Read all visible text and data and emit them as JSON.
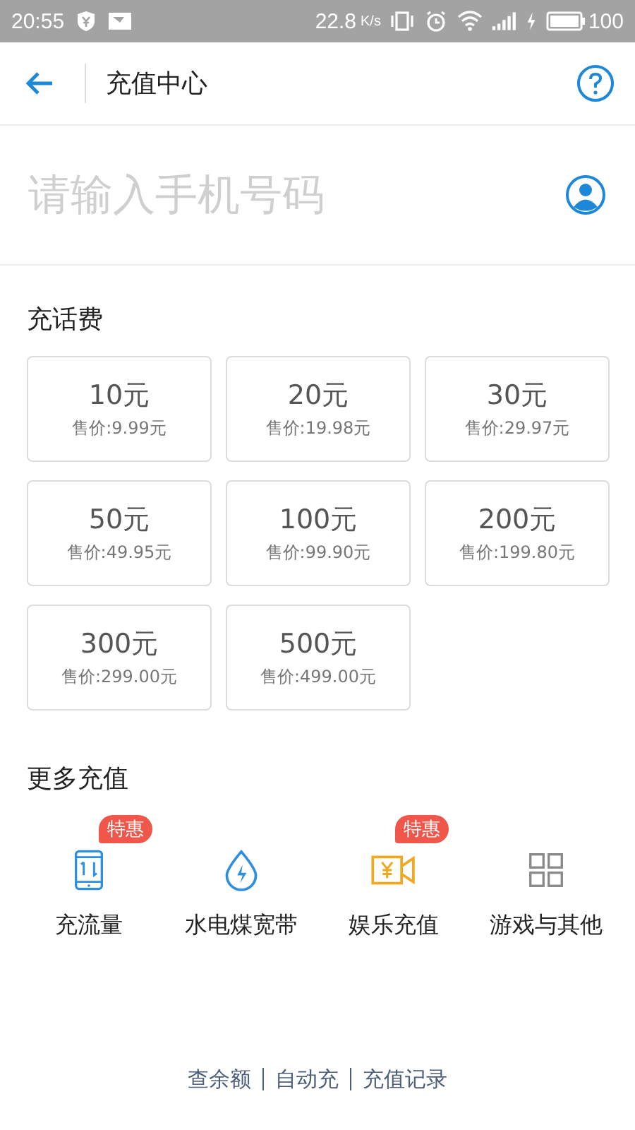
{
  "status_bar": {
    "time": "20:55",
    "speed": "22.8",
    "speed_unit": "K/s",
    "battery": "100"
  },
  "header": {
    "title": "充值中心"
  },
  "phone_field": {
    "placeholder": "请输入手机号码"
  },
  "topup": {
    "title": "充话费",
    "options": [
      {
        "amount": "10元",
        "price": "售价:9.99元"
      },
      {
        "amount": "20元",
        "price": "售价:19.98元"
      },
      {
        "amount": "30元",
        "price": "售价:29.97元"
      },
      {
        "amount": "50元",
        "price": "售价:49.95元"
      },
      {
        "amount": "100元",
        "price": "售价:99.90元"
      },
      {
        "amount": "200元",
        "price": "售价:199.80元"
      },
      {
        "amount": "300元",
        "price": "售价:299.00元"
      },
      {
        "amount": "500元",
        "price": "售价:499.00元"
      }
    ]
  },
  "more": {
    "title": "更多充值",
    "items": [
      {
        "kind": "data",
        "label": "充流量",
        "badge": "特惠"
      },
      {
        "kind": "utility",
        "label": "水电煤宽带"
      },
      {
        "kind": "entertainment",
        "label": "娱乐充值",
        "badge": "特惠"
      },
      {
        "kind": "games",
        "label": "游戏与其他"
      }
    ]
  },
  "footer": {
    "links": [
      "查余额",
      "自动充",
      "充值记录"
    ]
  }
}
